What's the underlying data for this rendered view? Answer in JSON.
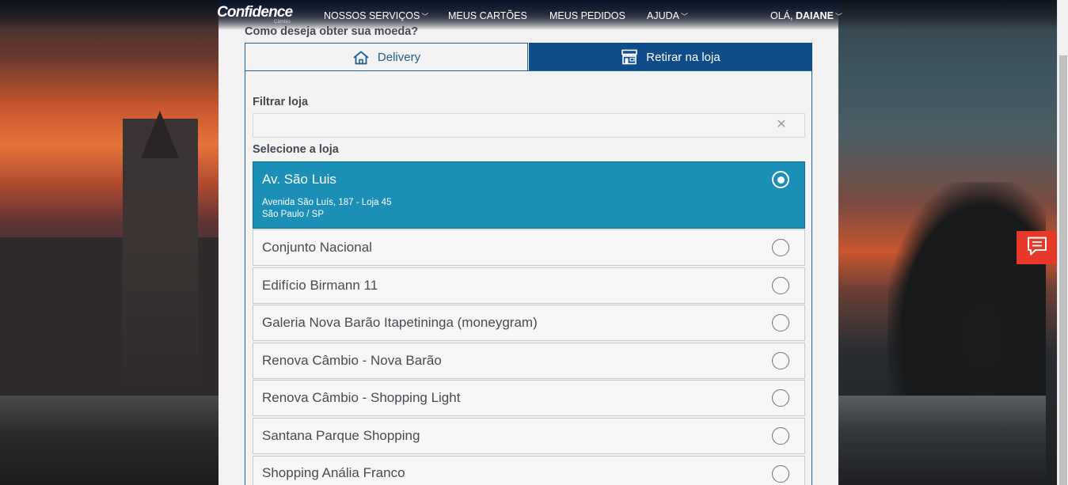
{
  "nav": {
    "logo": "Confidence",
    "logo_sub": "Câmbio",
    "items": [
      {
        "label": "NOSSOS SERVIÇOS",
        "has_dropdown": true
      },
      {
        "label": "MEUS CARTÕES",
        "has_dropdown": false
      },
      {
        "label": "MEUS PEDIDOS",
        "has_dropdown": false
      },
      {
        "label": "AJUDA",
        "has_dropdown": true
      }
    ],
    "greeting_prefix": "OLÁ,",
    "user_name": "DAIANE"
  },
  "question": "Como deseja obter sua moeda?",
  "tabs": {
    "delivery": {
      "label": "Delivery",
      "icon": "home-icon",
      "active": false
    },
    "store": {
      "label": "Retirar na loja",
      "icon": "store-icon",
      "active": true
    }
  },
  "filter": {
    "label": "Filtrar loja",
    "value": "",
    "placeholder": ""
  },
  "select_label": "Selecione a loja",
  "stores": [
    {
      "name": "Av. São Luis",
      "address_line1": "Avenida São Luís, 187 - Loja 45",
      "address_line2": "São Paulo / SP",
      "selected": true
    },
    {
      "name": "Conjunto Nacional",
      "selected": false
    },
    {
      "name": "Edifício Birmann 11",
      "selected": false
    },
    {
      "name": "Galeria Nova Barão Itapetininga (moneygram)",
      "selected": false
    },
    {
      "name": "Renova Câmbio - Nova Barão",
      "selected": false
    },
    {
      "name": "Renova Câmbio - Shopping Light",
      "selected": false
    },
    {
      "name": "Santana Parque Shopping",
      "selected": false
    },
    {
      "name": "Shopping Anália Franco",
      "selected": false
    }
  ],
  "colors": {
    "primary": "#0f4d8a",
    "selected": "#1b8fb5",
    "chat": "#e8382a"
  }
}
